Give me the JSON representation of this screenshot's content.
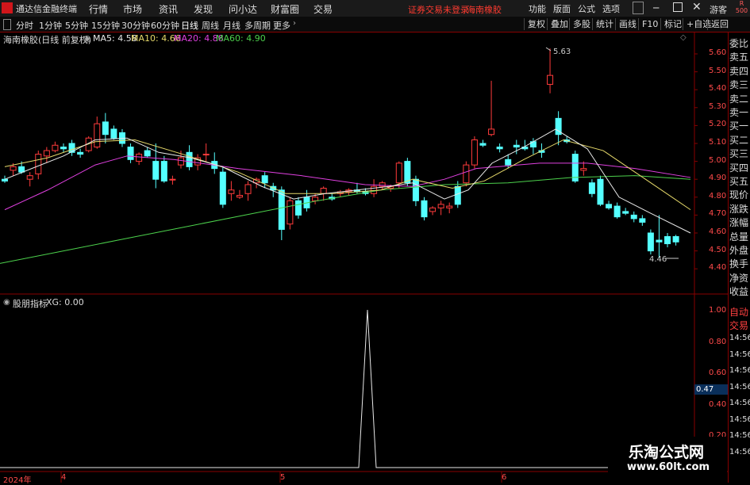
{
  "titlebar": {
    "app_name": "通达信金融终端",
    "menus": [
      "行情",
      "市场",
      "资讯",
      "发现",
      "问小达",
      "财富圈",
      "交易"
    ],
    "status_warning": "证券交易未登录",
    "stock_name": "海南橡胶",
    "right_menus": [
      "功能",
      "版面",
      "公式",
      "选项"
    ],
    "user": "游客",
    "badge": "R 500"
  },
  "toolbar": {
    "periods": [
      "分时",
      "1分钟",
      "5分钟",
      "15分钟",
      "30分钟",
      "60分钟",
      "日线",
      "周线",
      "月线",
      "多周期",
      "更多"
    ],
    "active_period": "日线",
    "buttons": [
      "复权",
      "叠加",
      "多股",
      "统计",
      "画线",
      "F10",
      "标记",
      "+自选",
      "返回"
    ]
  },
  "main_chart": {
    "title": "海南橡胶(日线 前复权)",
    "ma": [
      {
        "label": "MA5: 4.58",
        "color": "#e8e8e8"
      },
      {
        "label": "MA10: 4.66",
        "color": "#e6d96a"
      },
      {
        "label": "MA20: 4.88",
        "color": "#e040e0"
      },
      {
        "label": "MA60: 4.90",
        "color": "#4cd14c"
      }
    ],
    "high_label": "5.63",
    "low_label": "4.46",
    "y_labels": [
      "5.60",
      "5.50",
      "5.40",
      "5.30",
      "5.20",
      "5.10",
      "5.00",
      "4.90",
      "4.80",
      "4.70",
      "4.60",
      "4.50",
      "4.40"
    ],
    "colors": {
      "up": "#ff3b3b",
      "down": "#54ffff",
      "grid_red": "#880000"
    }
  },
  "indicator": {
    "title": "股朋指标",
    "value": "XG: 0.00",
    "y_labels": [
      "1.00",
      "0.80",
      "0.60",
      "0.40",
      "0.20"
    ],
    "current_tag": "0.47"
  },
  "x_axis": {
    "year": "2024年",
    "months": [
      "4",
      "5",
      "6"
    ]
  },
  "right_panel": {
    "items": [
      "委比",
      "卖五",
      "卖四",
      "卖三",
      "卖二",
      "卖一",
      "买一",
      "买二",
      "买三",
      "买四",
      "买五",
      "现价",
      "涨跌",
      "涨幅",
      "总量",
      "外盘",
      "换手",
      "净资",
      "收益",
      "自动",
      "交易",
      "14:56",
      "14:56",
      "14:56",
      "14:56",
      "14:56",
      "14:56",
      "14:56",
      "14:56"
    ]
  },
  "watermark": {
    "line1": "乐淘公式网",
    "line2": "www.60lt.com"
  }
}
